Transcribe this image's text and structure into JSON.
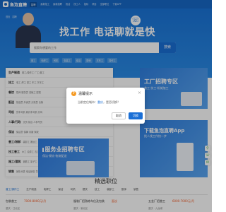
{
  "nav": {
    "logo": "鱼泡直聘",
    "links": [
      "招聘",
      "最新招工",
      "最新招聘",
      "找活",
      "找工人",
      "招标",
      "项目",
      "全部职位",
      "下载APP"
    ],
    "active_index": 0
  },
  "hero": {
    "crumbs": [
      "首页",
      "招聘"
    ],
    "slogan": "找工作 电话聊就是快",
    "bubble": "☏",
    "search_placeholder": "搜索你想要的工作",
    "search_button": "搜索",
    "hot_tags": [
      "普工",
      "电焊工",
      "司机",
      "包装工",
      "保洁",
      "厨师",
      "叉车工",
      "操作工"
    ]
  },
  "categories": [
    {
      "title": "生产制造",
      "subs": "普工/操作工  厂工/普工"
    },
    {
      "title": "技工",
      "subs": "电工 焊工 钳工 车工 叉车工"
    },
    {
      "title": "餐饮",
      "subs": "厨师 服务员 洗碗工 配菜"
    },
    {
      "title": "配送",
      "subs": "快递员 外卖员 分拣员 仓管"
    },
    {
      "title": "司机",
      "subs": "货车司机 网约车司机 代驾"
    },
    {
      "title": "人事/行政",
      "subs": "文员 前台 人事专员"
    },
    {
      "title": "保洁",
      "subs": "保洁员 保姆 月嫂 家政"
    },
    {
      "title": "普工/装卸",
      "subs": "装卸工 搬运工 打包工"
    },
    {
      "title": "技工普工",
      "subs": "木工 油漆工 瓦工 水电工"
    },
    {
      "title": "施工/建筑",
      "subs": "钢筋工 架子工 杂工"
    },
    {
      "title": "销售",
      "subs": "销售代表 电话销售 导购"
    }
  ],
  "banners": [
    {
      "title": "工厂招聘专区",
      "sub": "普工·技工·机械加工"
    },
    {
      "title": "服务业招聘专区",
      "sub": "保洁·餐饮·物流配送"
    },
    {
      "title": "下载鱼泡直聘App",
      "sub": "找人找工作快一步"
    }
  ],
  "modal": {
    "title": "温馨提示",
    "close": "×",
    "message_prefix": "当前定位城市：",
    "message_link": "重庆",
    "message_suffix": "，是否切换？",
    "cancel": "取消",
    "ok": "切换"
  },
  "jobs": {
    "heading": "精选职位",
    "tabs": [
      "普工/操作工",
      "生产制造",
      "电焊工",
      "保洁",
      "司机",
      "餐饮",
      "技工",
      "装卸工",
      "厨师",
      "销售"
    ],
    "active_tab": 0,
    "items": [
      {
        "title": "包装普工",
        "salary": "7000-8000元/月"
      },
      {
        "title": "服装厂招熟练车位及包装",
        "salary": "面议"
      },
      {
        "title": "五金厂招普工",
        "salary": "6000-7000元/月"
      }
    ],
    "meta": [
      "重庆 · 江北区",
      "重庆 · 渝北区",
      "重庆 · 九龙坡"
    ]
  },
  "side": [
    "⚲",
    "☏",
    "✉"
  ],
  "colors": {
    "brand": "#1a6fd6",
    "accent": "#f35a25",
    "warn": "#f59a23"
  }
}
